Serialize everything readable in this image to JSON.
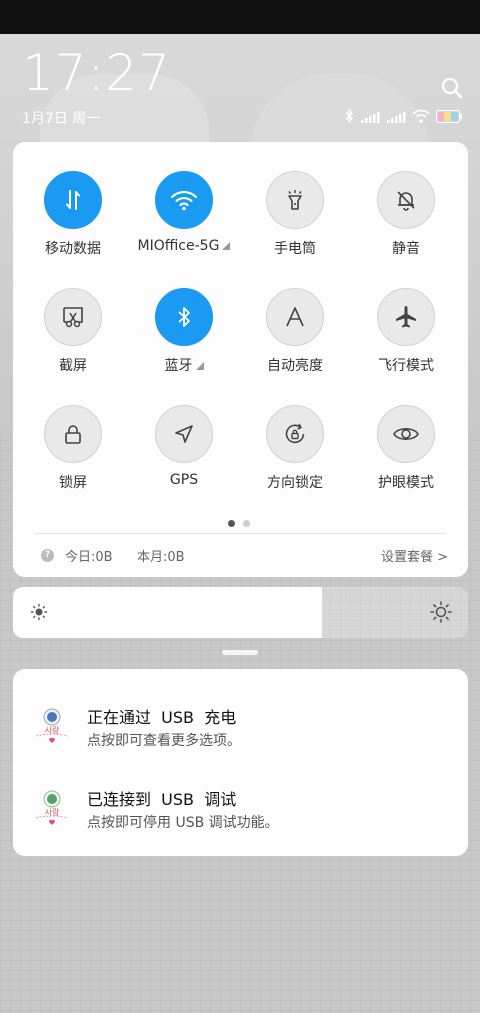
{
  "status": {
    "time": "17:27",
    "date": "1月7日 周一"
  },
  "quick_settings": {
    "tiles": [
      {
        "label": "移动数据",
        "on": true,
        "icon": "mobile-data-icon"
      },
      {
        "label": "MIOffice-5G",
        "on": true,
        "icon": "wifi-icon"
      },
      {
        "label": "手电筒",
        "on": false,
        "icon": "flashlight-icon"
      },
      {
        "label": "静音",
        "on": false,
        "icon": "bell-off-icon"
      },
      {
        "label": "截屏",
        "on": false,
        "icon": "screenshot-icon"
      },
      {
        "label": "蓝牙",
        "on": true,
        "icon": "bluetooth-icon"
      },
      {
        "label": "自动亮度",
        "on": false,
        "icon": "auto-brightness-icon"
      },
      {
        "label": "飞行模式",
        "on": false,
        "icon": "airplane-icon"
      },
      {
        "label": "锁屏",
        "on": false,
        "icon": "lock-icon"
      },
      {
        "label": "GPS",
        "on": false,
        "icon": "gps-icon"
      },
      {
        "label": "方向锁定",
        "on": false,
        "icon": "rotation-lock-icon"
      },
      {
        "label": "护眼模式",
        "on": false,
        "icon": "eye-icon"
      }
    ],
    "page_count": 2,
    "active_page": 1
  },
  "data_usage": {
    "today": "今日:0B",
    "month": "本月:0B",
    "settings_link": "设置套餐 >"
  },
  "brightness": {
    "level_fraction": 0.68
  },
  "notifications": [
    {
      "title": "正在通过  USB  充电",
      "subtitle": "点按即可查看更多选项。",
      "icon_color": "#4a78b8"
    },
    {
      "title": "已连接到  USB  调试",
      "subtitle": "点按即可停用 USB 调试功能。",
      "icon_color": "#5aa060"
    }
  ],
  "colors": {
    "accent": "#1a9af0",
    "tile_off_bg": "#e9e9e9",
    "status_bar": "#111111"
  }
}
